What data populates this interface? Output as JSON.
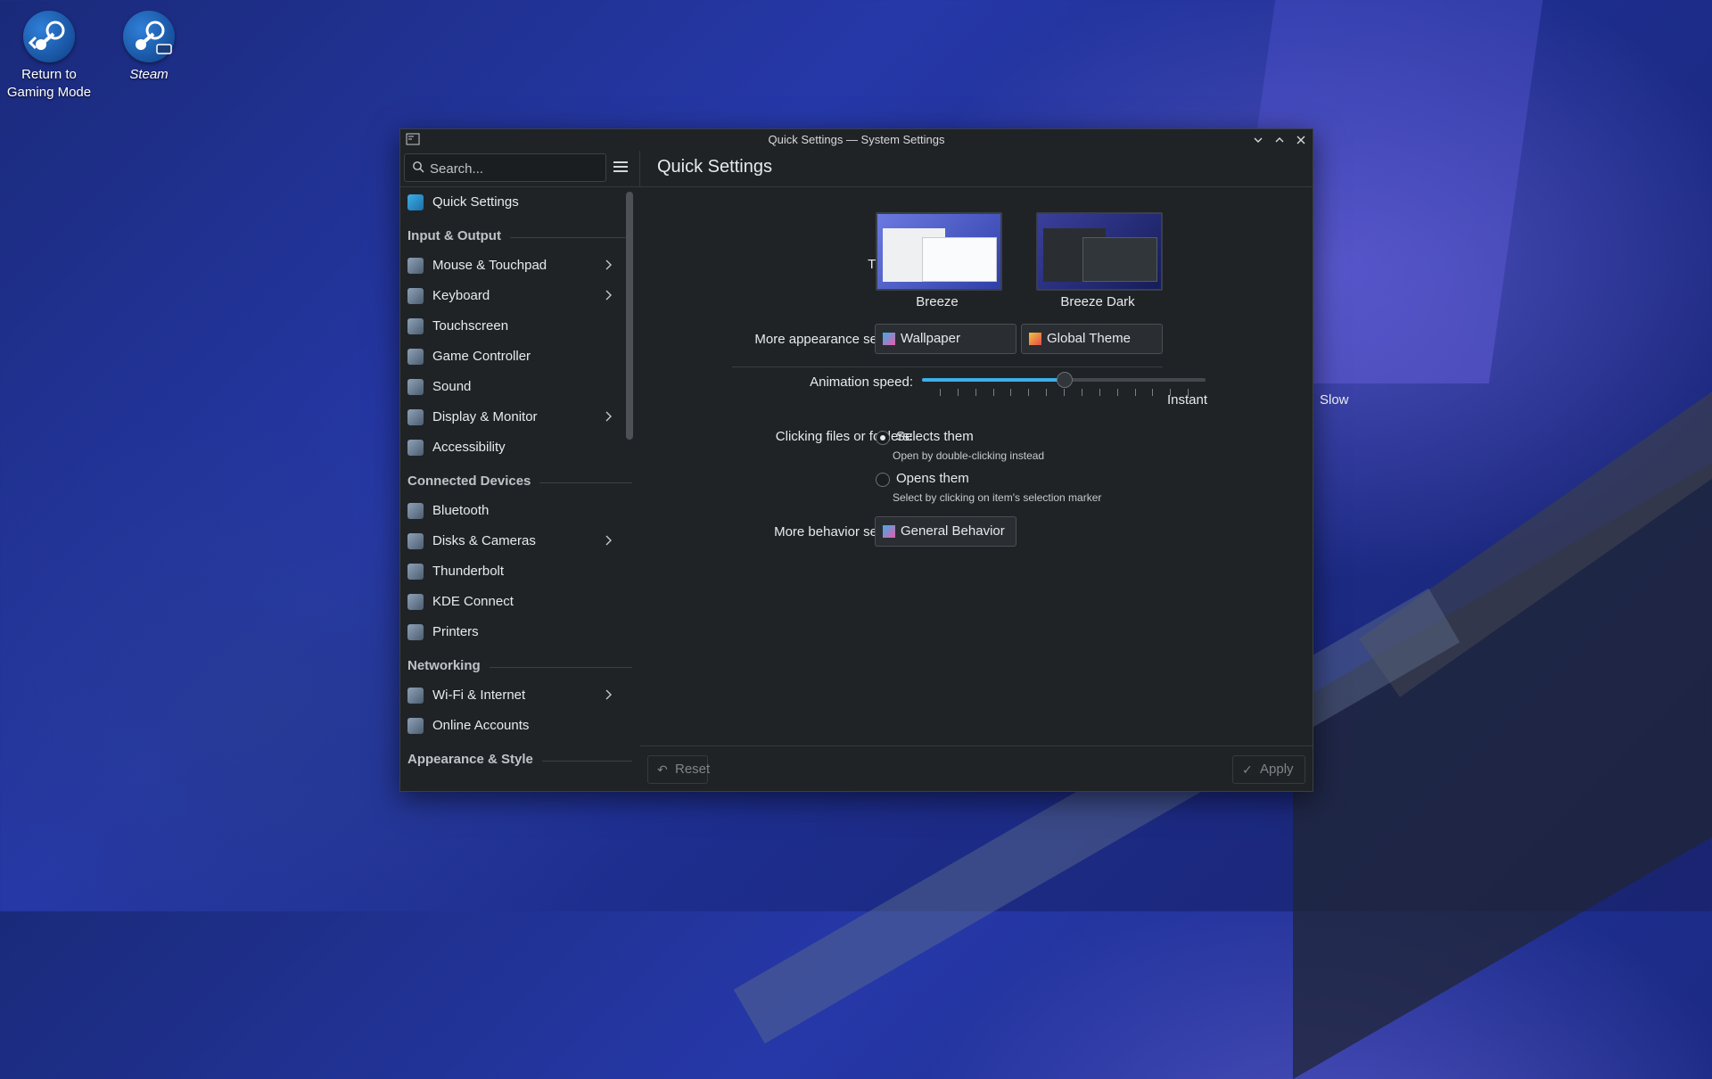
{
  "desktop": {
    "icons": [
      {
        "label": "Return to Gaming Mode"
      },
      {
        "label": "Steam"
      }
    ]
  },
  "window": {
    "title": "Quick Settings — System Settings"
  },
  "search": {
    "placeholder": "Search..."
  },
  "page_title": "Quick Settings",
  "sidebar": {
    "top_item": "Quick Settings",
    "sections": [
      {
        "heading": "Input & Output",
        "items": [
          {
            "label": "Mouse & Touchpad",
            "chevron": true,
            "icon": "mouse-icon"
          },
          {
            "label": "Keyboard",
            "chevron": true,
            "icon": "keyboard-icon"
          },
          {
            "label": "Touchscreen",
            "chevron": false,
            "icon": "touchscreen-icon"
          },
          {
            "label": "Game Controller",
            "chevron": false,
            "icon": "gamepad-icon"
          },
          {
            "label": "Sound",
            "chevron": false,
            "icon": "sound-icon"
          },
          {
            "label": "Display & Monitor",
            "chevron": true,
            "icon": "monitor-icon"
          },
          {
            "label": "Accessibility",
            "chevron": false,
            "icon": "accessibility-icon"
          }
        ]
      },
      {
        "heading": "Connected Devices",
        "items": [
          {
            "label": "Bluetooth",
            "chevron": false,
            "icon": "bluetooth-icon"
          },
          {
            "label": "Disks & Cameras",
            "chevron": true,
            "icon": "disk-icon"
          },
          {
            "label": "Thunderbolt",
            "chevron": false,
            "icon": "thunderbolt-icon"
          },
          {
            "label": "KDE Connect",
            "chevron": false,
            "icon": "phone-icon"
          },
          {
            "label": "Printers",
            "chevron": false,
            "icon": "printer-icon"
          }
        ]
      },
      {
        "heading": "Networking",
        "items": [
          {
            "label": "Wi-Fi & Internet",
            "chevron": true,
            "icon": "globe-icon"
          },
          {
            "label": "Online Accounts",
            "chevron": false,
            "icon": "accounts-icon"
          }
        ]
      },
      {
        "heading": "Appearance & Style",
        "items": []
      }
    ]
  },
  "content": {
    "theme_label": "Theme:",
    "themes": [
      {
        "name": "Breeze",
        "selected": false
      },
      {
        "name": "Breeze Dark",
        "selected": false
      }
    ],
    "appearance_label": "More appearance settings:",
    "appearance_buttons": [
      "Wallpaper",
      "Global Theme"
    ],
    "animation_label": "Animation speed:",
    "animation_value": 0.5,
    "animation_min_label": "Slow",
    "animation_max_label": "Instant",
    "clicking_label": "Clicking files or folders:",
    "click_options": [
      {
        "label": "Selects them",
        "sub": "Open by double-clicking instead",
        "checked": true
      },
      {
        "label": "Opens them",
        "sub": "Select by clicking on item's selection marker",
        "checked": false
      }
    ],
    "behavior_label": "More behavior settings:",
    "behavior_button": "General Behavior"
  },
  "footer": {
    "reset": "Reset",
    "apply": "Apply"
  },
  "colors": {
    "accent": "#3daee9",
    "window_bg": "#202326"
  }
}
